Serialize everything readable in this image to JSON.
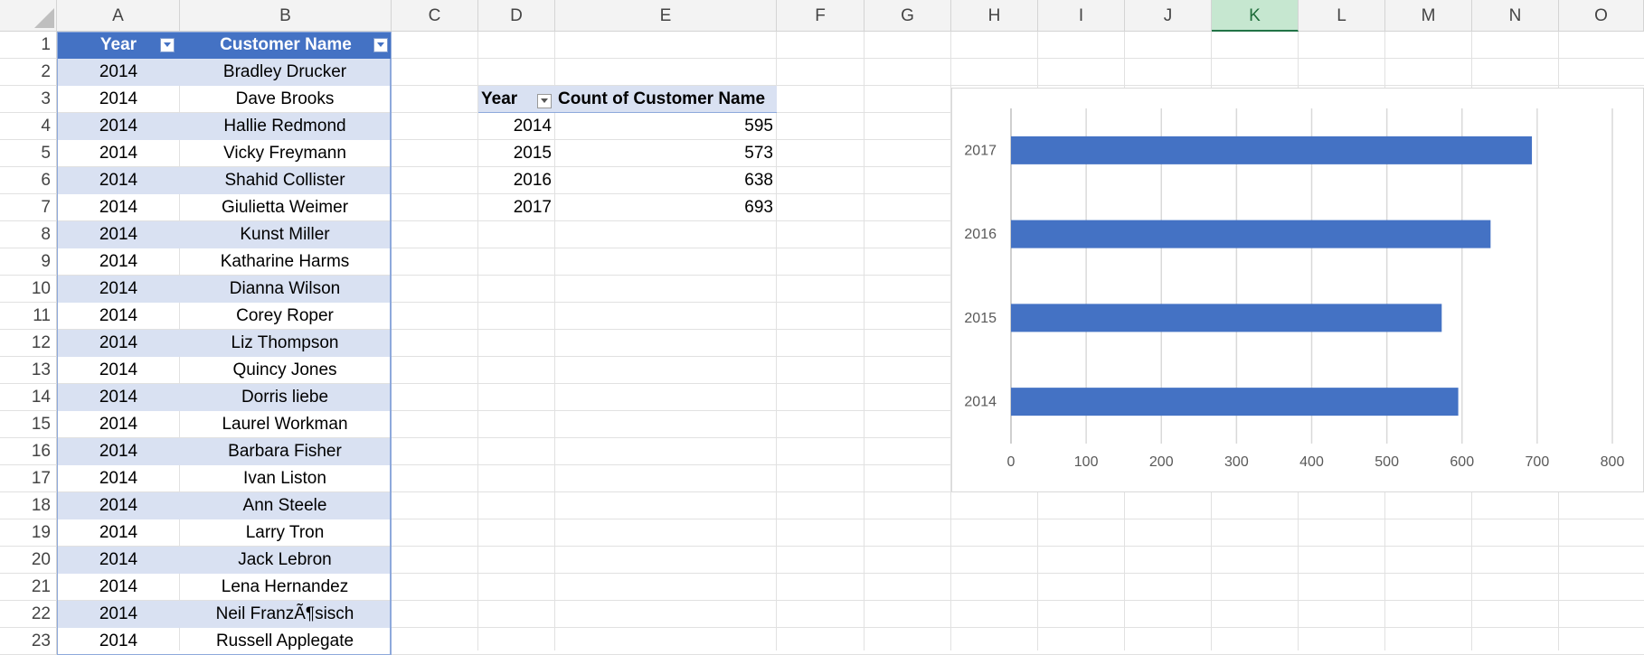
{
  "sheet": {
    "columns": [
      "A",
      "B",
      "C",
      "D",
      "E",
      "F",
      "G",
      "H",
      "I",
      "J",
      "K",
      "L",
      "M",
      "N",
      "O"
    ],
    "selected_column": "K",
    "row_numbers": [
      "1",
      "2",
      "3",
      "4",
      "5",
      "6",
      "7",
      "8",
      "9",
      "10",
      "11",
      "12",
      "13",
      "14",
      "15",
      "16",
      "17",
      "18",
      "19",
      "20",
      "21",
      "22",
      "23"
    ]
  },
  "table": {
    "headers": [
      "Year",
      "Customer Name"
    ],
    "rows": [
      [
        "2014",
        "Bradley Drucker"
      ],
      [
        "2014",
        "Dave Brooks"
      ],
      [
        "2014",
        "Hallie Redmond"
      ],
      [
        "2014",
        "Vicky Freymann"
      ],
      [
        "2014",
        "Shahid Collister"
      ],
      [
        "2014",
        "Giulietta Weimer"
      ],
      [
        "2014",
        "Kunst Miller"
      ],
      [
        "2014",
        "Katharine Harms"
      ],
      [
        "2014",
        "Dianna Wilson"
      ],
      [
        "2014",
        "Corey Roper"
      ],
      [
        "2014",
        "Liz Thompson"
      ],
      [
        "2014",
        "Quincy Jones"
      ],
      [
        "2014",
        "Dorris liebe"
      ],
      [
        "2014",
        "Laurel Workman"
      ],
      [
        "2014",
        "Barbara Fisher"
      ],
      [
        "2014",
        "Ivan Liston"
      ],
      [
        "2014",
        "Ann Steele"
      ],
      [
        "2014",
        "Larry Tron"
      ],
      [
        "2014",
        "Jack Lebron"
      ],
      [
        "2014",
        "Lena Hernandez"
      ],
      [
        "2014",
        "Neil FranzÃ¶sisch"
      ],
      [
        "2014",
        "Russell Applegate"
      ]
    ]
  },
  "pivot": {
    "row_label": "Year",
    "value_label": "Count of Customer Name",
    "rows": [
      [
        "2014",
        "595"
      ],
      [
        "2015",
        "573"
      ],
      [
        "2016",
        "638"
      ],
      [
        "2017",
        "693"
      ]
    ]
  },
  "chart_data": {
    "type": "bar",
    "orientation": "horizontal",
    "categories": [
      "2014",
      "2015",
      "2016",
      "2017"
    ],
    "values": [
      595,
      573,
      638,
      693
    ],
    "title": "",
    "xlabel": "",
    "ylabel": "",
    "xlim": [
      0,
      800
    ],
    "x_ticks": [
      "0",
      "100",
      "200",
      "300",
      "400",
      "500",
      "600",
      "700",
      "800"
    ],
    "grid": true,
    "legend": "none",
    "bar_color": "#4472c4"
  }
}
